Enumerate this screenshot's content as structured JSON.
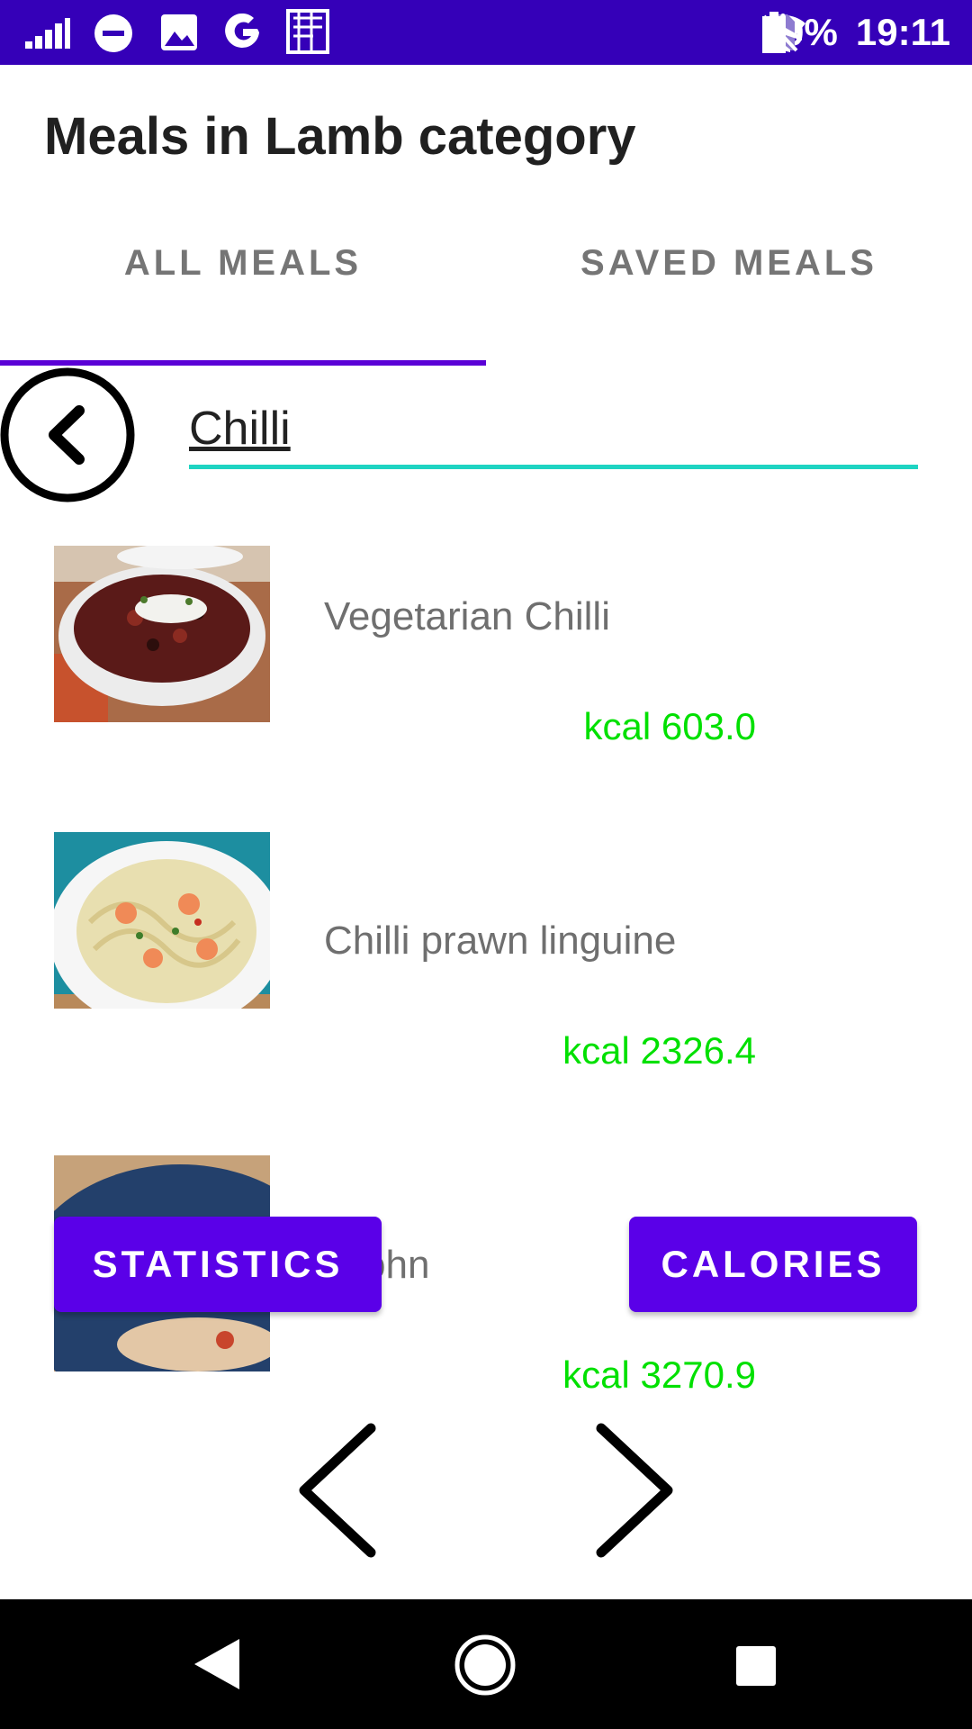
{
  "status_bar": {
    "battery": "80%",
    "time": "19:11",
    "icons": [
      "signal-bars-icon",
      "do-not-disturb-icon",
      "image-icon",
      "google-icon",
      "app-icon",
      "wifi-icon",
      "no-sim-icon",
      "airplane-icon",
      "battery-icon"
    ]
  },
  "title": "Meals in Lamb category",
  "tabs": [
    {
      "label": "ALL MEALS",
      "active": true
    },
    {
      "label": "SAVED MEALS",
      "active": false
    }
  ],
  "search": {
    "value": "Chilli",
    "placeholder": ""
  },
  "meals": [
    {
      "name": "Vegetarian Chilli",
      "kcal": "kcal 603.0",
      "image": "chilli-bowl-image"
    },
    {
      "name": "Chilli prawn linguine",
      "kcal": "kcal 2326.4",
      "image": "prawn-linguine-image"
    },
    {
      "name": "ti john",
      "kcal": "kcal 3270.9",
      "image": "dish-on-blue-plate-image"
    }
  ],
  "buttons": {
    "statistics": "STATISTICS",
    "calories": "CALORIES"
  },
  "colors": {
    "status_bar": "#3500b8",
    "accent": "#5a00e8",
    "search_underline": "#1ed4c2",
    "kcal": "#00e000"
  }
}
